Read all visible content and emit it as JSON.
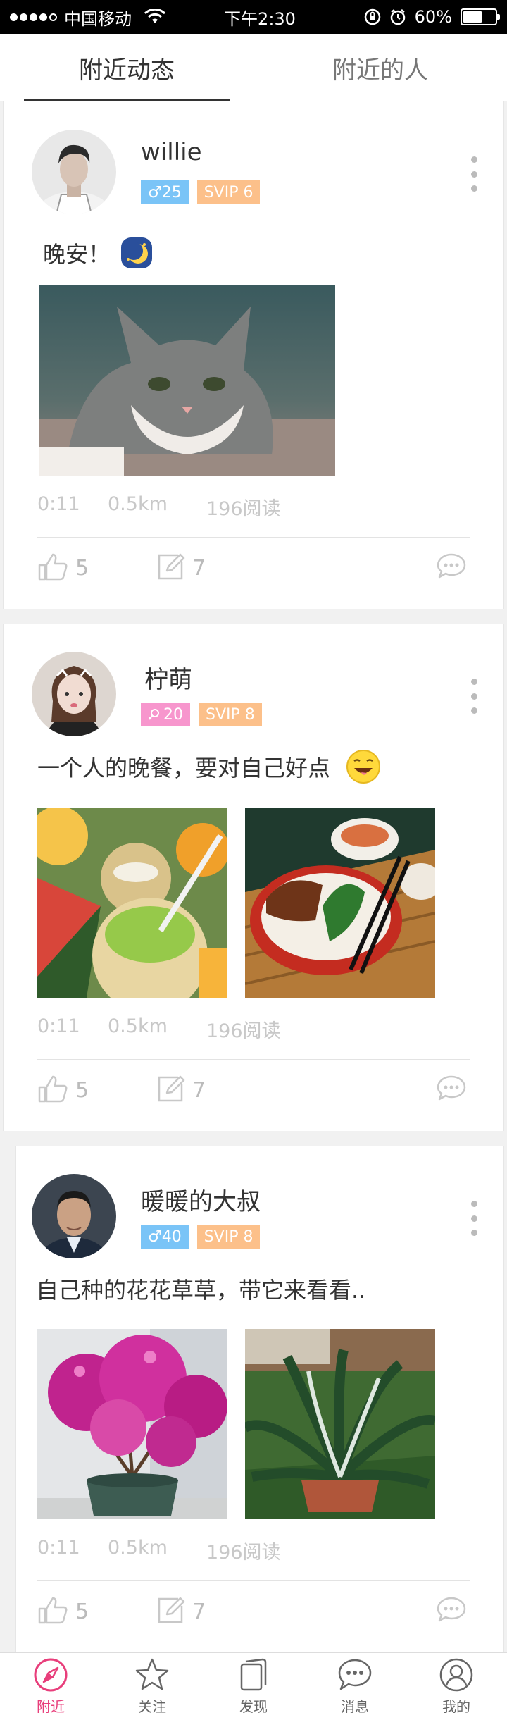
{
  "status_bar": {
    "carrier": "中国移动",
    "time": "下午2:30",
    "battery": "60%",
    "battery_level": 0.6
  },
  "tabs": [
    {
      "label": "附近动态",
      "active": true
    },
    {
      "label": "附近的人",
      "active": false
    }
  ],
  "posts": [
    {
      "username": "willie",
      "gender_badge": "♂25",
      "gender_icon": "male-icon",
      "svip": "SVIP 6",
      "text": "晚安！",
      "emoji": "moon-emoji-icon",
      "time": "0:11",
      "distance": "0.5km",
      "reads": "196阅读",
      "likes": "5",
      "comments": "7"
    },
    {
      "username": "柠萌",
      "gender_badge": "20",
      "gender_icon": "female-icon",
      "svip": "SVIP 8",
      "text": "一个人的晚餐，要对自己好点",
      "emoji": "smile-emoji-icon",
      "time": "0:11",
      "distance": "0.5km",
      "reads": "196阅读",
      "likes": "5",
      "comments": "7"
    },
    {
      "username": "暖暖的大叔",
      "gender_badge": "♂40",
      "gender_icon": "male-icon",
      "svip": "SVIP 8",
      "text": "自己种的花花草草，带它来看看..",
      "emoji": null,
      "time": "0:11",
      "distance": "0.5km",
      "reads": "196阅读",
      "likes": "5",
      "comments": "7"
    }
  ],
  "bottom_nav": [
    {
      "label": "附近",
      "icon": "compass-icon",
      "active": true
    },
    {
      "label": "关注",
      "icon": "star-icon",
      "active": false
    },
    {
      "label": "发现",
      "icon": "cards-icon",
      "active": false
    },
    {
      "label": "消息",
      "icon": "chat-icon",
      "active": false
    },
    {
      "label": "我的",
      "icon": "profile-icon",
      "active": false
    }
  ],
  "colors": {
    "accent": "#e83e7b",
    "male_badge": "#7ac4f7",
    "female_badge": "#f796cd",
    "svip_badge": "#fcc08a"
  }
}
